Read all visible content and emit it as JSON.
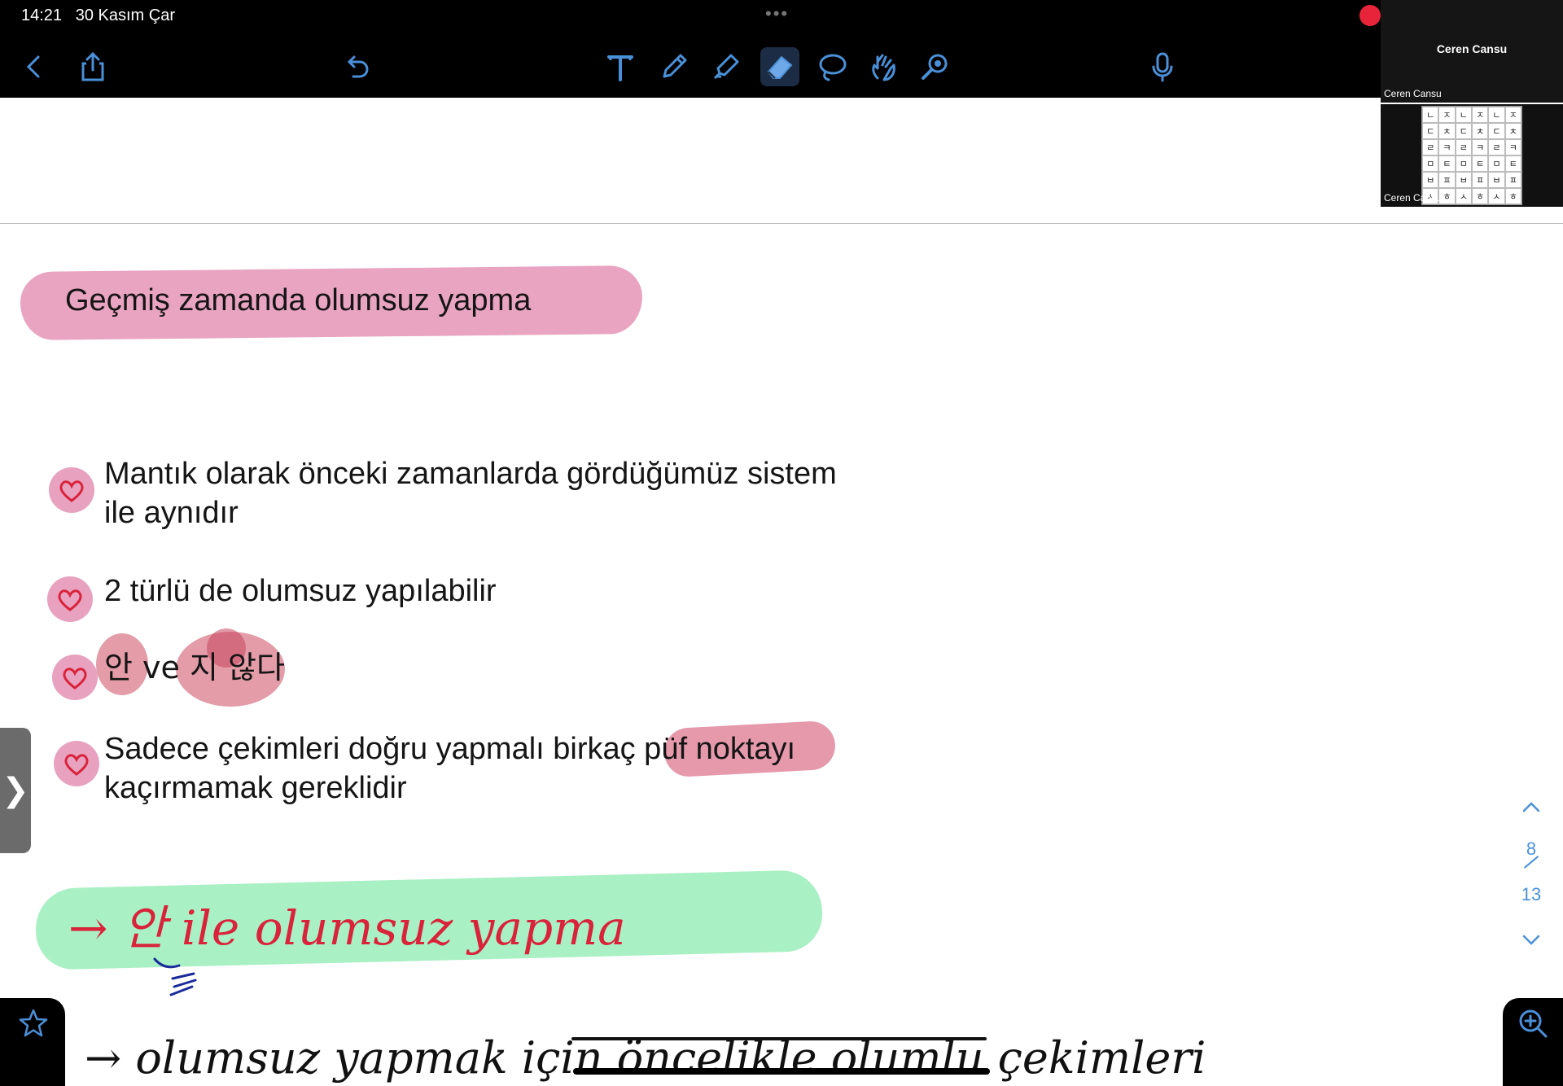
{
  "status_bar": {
    "time": "14:21",
    "date": "30 Kasım Çar",
    "dots": "•••"
  },
  "toolbar": {
    "back_icon": "chevron-left-icon",
    "share_icon": "share-icon",
    "undo_icon": "undo-icon",
    "tools": [
      "text-tool-icon",
      "pen-icon",
      "highlighter-icon",
      "eraser-icon",
      "lasso-icon",
      "hand-icon",
      "laser-pointer-icon"
    ],
    "mic_icon": "microphone-icon"
  },
  "video": {
    "top_name": "Ceren Cansu",
    "top_label": "Ceren Cansu",
    "bottom_label": "Ceren Cansu",
    "hangul": [
      "ㄴ",
      "ㅈ",
      "ㄴ",
      "ㅈ",
      "ㄴ",
      "ㅈ",
      "ㄷ",
      "ㅊ",
      "ㄷ",
      "ㅊ",
      "ㄷ",
      "ㅊ",
      "ㄹ",
      "ㅋ",
      "ㄹ",
      "ㅋ",
      "ㄹ",
      "ㅋ",
      "ㅁ",
      "ㅌ",
      "ㅁ",
      "ㅌ",
      "ㅁ",
      "ㅌ",
      "ㅂ",
      "ㅍ",
      "ㅂ",
      "ㅍ",
      "ㅂ",
      "ㅍ",
      "ㅅ",
      "ㅎ",
      "ㅅ",
      "ㅎ",
      "ㅅ",
      "ㅎ"
    ]
  },
  "note": {
    "heading": "Geçmiş zamanda olumsuz yapma",
    "bullets": [
      {
        "line1": "Mantık olarak önceki zamanlarda gördüğümüz sistem",
        "line2": "ile aynıdır"
      },
      {
        "line1": "2 türlü de olumsuz yapılabilir"
      },
      {
        "line1": "안 ve 지 않다"
      },
      {
        "line1": "Sadece çekimleri doğru yapmalı birkaç püf noktayı",
        "line2": "kaçırmamak gereklidir"
      }
    ],
    "handwriting_green": "→ 안 ile olumsuz yapma",
    "handwriting_line1": "→ olumsuz yapmak için öncelikle olumlu çekimleri"
  },
  "pager": {
    "current": "8",
    "total": "13"
  },
  "colors": {
    "pink": "#e9a4c1",
    "green": "#a9f0c4",
    "ink_red": "#d9233a",
    "ink_black": "#111111",
    "accent_blue": "#4a90d9"
  }
}
